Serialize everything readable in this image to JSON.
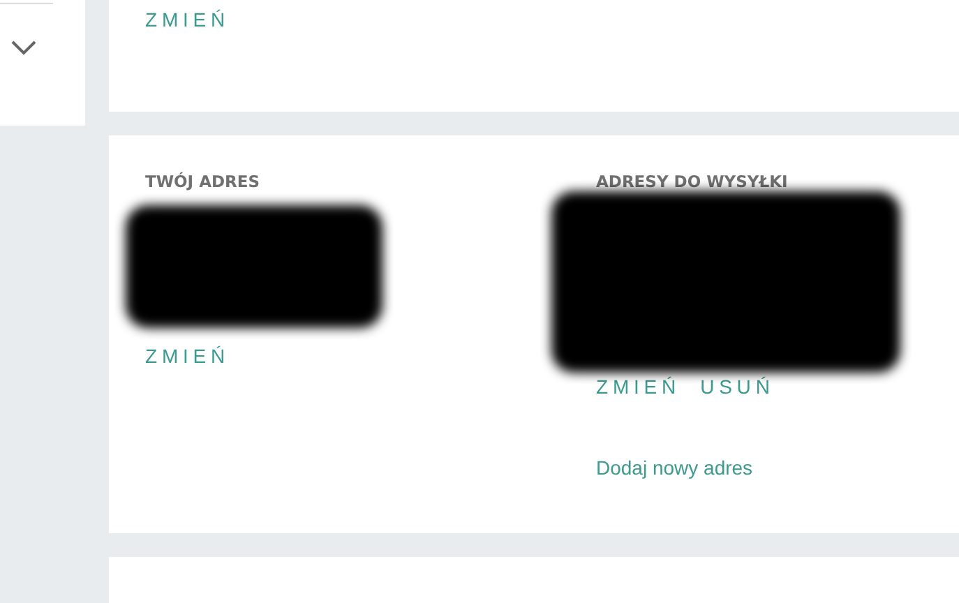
{
  "sidebar": {
    "expanded": false
  },
  "top_card": {
    "links": [
      "ZMIEŃ"
    ]
  },
  "address_card": {
    "your_address": {
      "heading": "TWÓJ ADRES",
      "links": [
        "ZMIEŃ"
      ]
    },
    "shipping_addresses": {
      "heading": "ADRESY DO WYSYŁKI",
      "links": [
        "ZMIEŃ",
        "USUŃ"
      ],
      "add_link": "Dodaj nowy adres"
    }
  }
}
